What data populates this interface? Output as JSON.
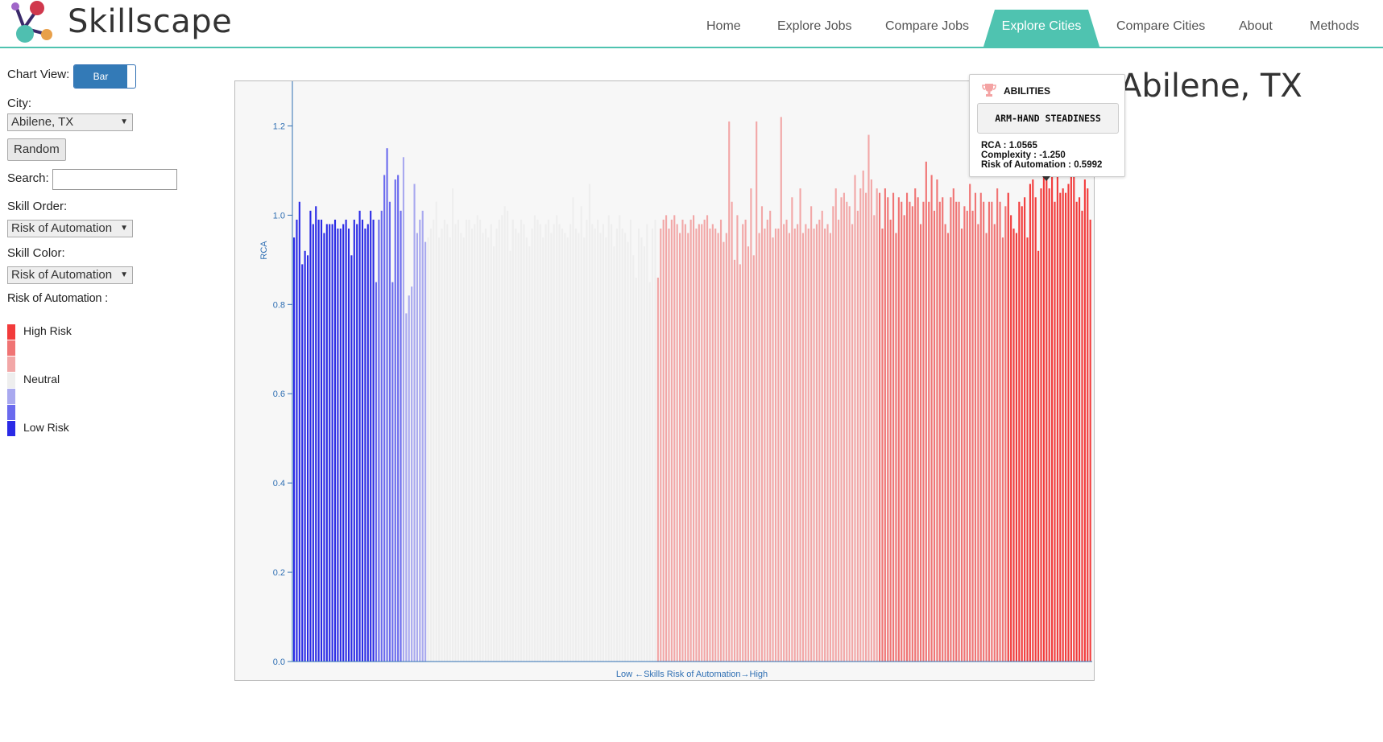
{
  "app": {
    "brand": "Skillscape"
  },
  "nav": [
    {
      "label": "Home",
      "active": false
    },
    {
      "label": "Explore Jobs",
      "active": false
    },
    {
      "label": "Compare Jobs",
      "active": false
    },
    {
      "label": "Explore Cities",
      "active": true
    },
    {
      "label": "Compare Cities",
      "active": false
    },
    {
      "label": "About",
      "active": false
    },
    {
      "label": "Methods",
      "active": false
    }
  ],
  "sidebar": {
    "chart_view_label": "Chart View:",
    "chart_view_toggle": "Bar",
    "city_label": "City:",
    "city_value": "Abilene, TX",
    "random_button": "Random",
    "search_label": "Search:",
    "search_value": "",
    "skill_order_label": "Skill Order:",
    "skill_order_value": "Risk of Automation",
    "skill_color_label": "Skill Color:",
    "skill_color_value": "Risk of Automation",
    "legend_title": "Risk of Automation :",
    "legend_high": "High Risk",
    "legend_neutral": "Neutral",
    "legend_low": "Low Risk",
    "legend_colors": [
      "#f23b3b",
      "#f07474",
      "#f2a7a7",
      "#eeeeee",
      "#a9a9ef",
      "#6a6aee",
      "#2a2ae6"
    ]
  },
  "city_title": "Abilene, TX",
  "tooltip": {
    "category": "ABILITIES",
    "skill": "ARM-HAND STEADINESS",
    "rca": "RCA : 1.0565",
    "complexity": "Complexity : -1.250",
    "risk": "Risk of Automation : 0.5992"
  },
  "chart_data": {
    "type": "bar",
    "ylabel": "RCA",
    "xlabel": "Low ←Skills Risk of Automation→High",
    "ylim": [
      0,
      1.3
    ],
    "yticks": [
      "0.0",
      "0.2",
      "0.4",
      "0.6",
      "0.8",
      "1.0",
      "1.2"
    ],
    "group_colors": [
      "#2a2ae6",
      "#6a6aee",
      "#a9a9ef",
      "#eeeeee",
      "#f2a7a7",
      "#f07474",
      "#f23b3b"
    ],
    "groups": [
      [
        0.95,
        0.99,
        1.03,
        0.89,
        0.92,
        0.91,
        1.01,
        0.98,
        1.02,
        0.99,
        0.99,
        0.96,
        0.98,
        0.98,
        0.98,
        0.99,
        0.97,
        0.97,
        0.98,
        0.99,
        0.97,
        0.91,
        0.99,
        0.98,
        1.01,
        0.99,
        0.97,
        0.98,
        1.01,
        0.99
      ],
      [
        0.85,
        0.99,
        1.01,
        1.09,
        1.15,
        1.03,
        0.85,
        1.08,
        1.09,
        1.01
      ],
      [
        1.13,
        0.78,
        0.82,
        0.84,
        1.07,
        0.96,
        0.99,
        1.01,
        0.94
      ],
      [
        0.95,
        0.97,
        0.99,
        1.03,
        0.95,
        0.97,
        0.99,
        0.98,
        0.95,
        1.06,
        0.98,
        0.99,
        0.96,
        0.95,
        0.99,
        0.99,
        0.97,
        0.98,
        1.0,
        0.99,
        0.96,
        0.97,
        0.95,
        0.98,
        0.93,
        0.97,
        0.99,
        1.0,
        1.02,
        1.01,
        0.92,
        0.99,
        0.97,
        0.96,
        0.99,
        0.98,
        0.95,
        0.93,
        0.97,
        1.0,
        0.99,
        0.98,
        0.95,
        0.98,
        0.99,
        0.96,
        0.98,
        1.0,
        0.98,
        0.97,
        0.96,
        0.95,
        0.98,
        1.04,
        0.97,
        0.96,
        1.02,
        0.95,
        0.99,
        1.07,
        0.98,
        0.97,
        0.99,
        0.96,
        0.98,
        0.95,
        1.0,
        0.98,
        0.93,
        0.97,
        1.0,
        0.97,
        0.96,
        0.94,
        0.99,
        0.91,
        0.86,
        0.97,
        0.95,
        0.93,
        0.98,
        0.85,
        0.97,
        0.99
      ],
      [
        0.86,
        0.97,
        0.99,
        1.0,
        0.97,
        0.99,
        1.0,
        0.98,
        0.96,
        0.99,
        0.98,
        0.96,
        0.99,
        1.0,
        0.97,
        0.98,
        0.98,
        0.99,
        1.0,
        0.97,
        0.98,
        0.97,
        0.96,
        0.99,
        0.94,
        0.96,
        1.21,
        1.03,
        0.9,
        1.0,
        0.89,
        0.98,
        0.99,
        0.93,
        1.06,
        0.91,
        1.21,
        0.96,
        1.02,
        0.97,
        0.99,
        1.01,
        0.95,
        0.97,
        0.97,
        1.22,
        0.98,
        0.99,
        0.96,
        1.04,
        0.97,
        0.98,
        1.06,
        0.96,
        0.98,
        0.97,
        1.02,
        0.97,
        0.98,
        0.99,
        1.01,
        0.97,
        0.98,
        0.96,
        1.02,
        1.06,
        0.99,
        1.04,
        1.05,
        1.03,
        1.02,
        0.98,
        1.09,
        1.01,
        1.06,
        1.1,
        1.05,
        1.18,
        1.08,
        1.0,
        1.06
      ],
      [
        1.05,
        0.97,
        1.06,
        1.04,
        0.99,
        1.05,
        0.96,
        1.04,
        1.03,
        1.0,
        1.05,
        1.03,
        1.02,
        1.06,
        1.04,
        0.98,
        1.03,
        1.12,
        1.03,
        1.09,
        1.01,
        1.08,
        1.03,
        1.04,
        0.98,
        0.96,
        1.04,
        1.06,
        1.03,
        1.03,
        0.97,
        1.02,
        1.01,
        1.07,
        1.01,
        1.05,
        0.98,
        1.05,
        1.03,
        0.96,
        1.03,
        1.03,
        0.98,
        1.06,
        1.03,
        0.95,
        1.02
      ],
      [
        1.05,
        1.0,
        0.97,
        0.96,
        1.03,
        1.02,
        1.04,
        0.95,
        1.07,
        1.08,
        1.04,
        0.92,
        1.06,
        1.12,
        1.08,
        1.06,
        1.1,
        1.03,
        1.09,
        1.05,
        1.06,
        1.05,
        1.07,
        1.09,
        1.1,
        1.03,
        1.04,
        1.01,
        1.08,
        1.06,
        0.99
      ]
    ]
  }
}
